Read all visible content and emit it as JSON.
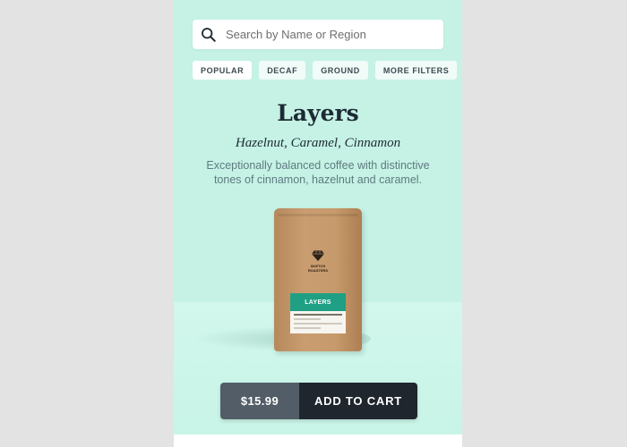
{
  "search": {
    "placeholder": "Search by Name or Region",
    "value": ""
  },
  "filters": [
    {
      "label": "POPULAR",
      "active": true
    },
    {
      "label": "DECAF",
      "active": false
    },
    {
      "label": "GROUND",
      "active": false
    },
    {
      "label": "MORE FILTERS",
      "active": false
    }
  ],
  "product": {
    "name": "Layers",
    "notes": "Hazelnut, Caramel, Cinnamon",
    "description": "Exceptionally balanced coffee with distinctive tones of cinnamon, hazelnut and caramel.",
    "bag_brand_line1": "SKETCH",
    "bag_brand_line2": "ROASTERS",
    "bag_label": "LAYERS",
    "price": "$15.99"
  },
  "cta": {
    "label": "ADD TO CART"
  },
  "colors": {
    "background": "#c5f2e5",
    "label_accent": "#1f9f84",
    "cta_dark": "#1f262d",
    "cta_price": "#525d67"
  },
  "icons": {
    "search": "search-icon",
    "logo": "diamond-logo-icon"
  }
}
